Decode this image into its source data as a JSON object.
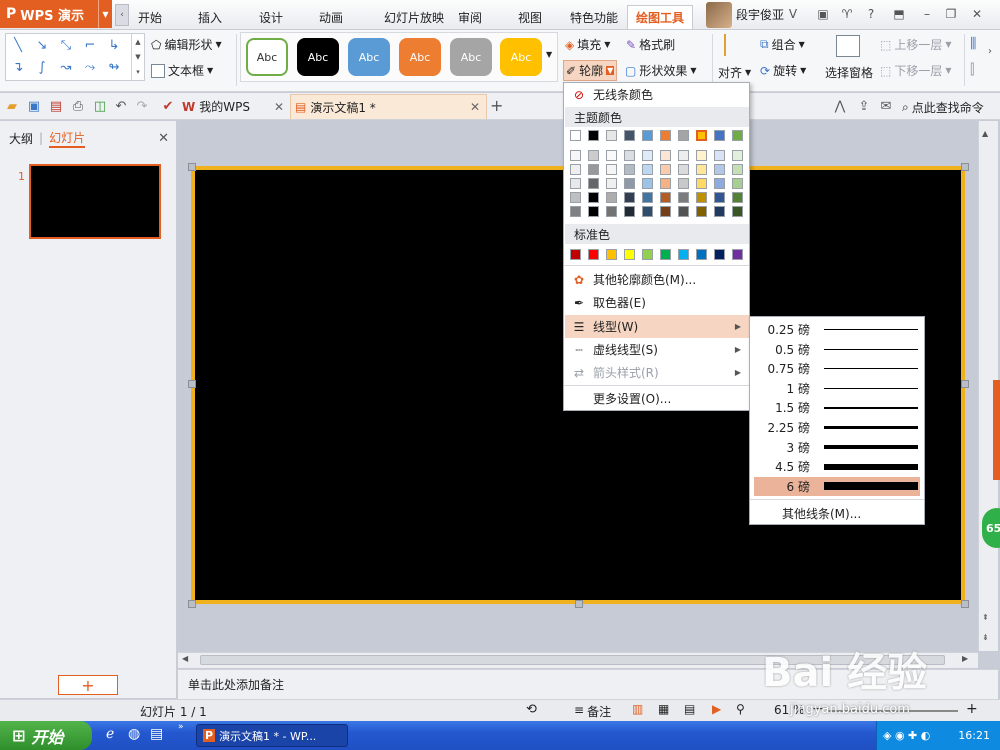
{
  "app": {
    "logo_text": "WPS 演示",
    "logo_letter": "P"
  },
  "menu": {
    "tabs": [
      "开始",
      "插入",
      "设计",
      "动画",
      "幻灯片放映",
      "审阅",
      "视图",
      "特色功能",
      "绘图工具"
    ],
    "user": "段宇俊亚"
  },
  "ribbon": {
    "edit_shape": "编辑形状",
    "text_box": "文本框",
    "style_label": "Abc",
    "fill": "填充",
    "format_painter": "格式刷",
    "outline": "轮廓",
    "shape_effect": "形状效果",
    "align": "对齐",
    "group": "组合",
    "rotate": "旋转",
    "selection_pane": "选择窗格",
    "bring_forward": "上移一层",
    "send_backward": "下移一层"
  },
  "colors": {
    "accent": "#e35f21",
    "slide_border": "#f0b21c",
    "style_colors": [
      "#ffffff",
      "#000000",
      "#5b9bd5",
      "#ed7d31",
      "#a5a5a5",
      "#ffc000"
    ],
    "theme_row": [
      "#ffffff",
      "#000000",
      "#e7e6e6",
      "#44546a",
      "#5b9bd5",
      "#ed7d31",
      "#a5a5a5",
      "#ffc000",
      "#4472c4",
      "#70ad47"
    ],
    "standard_row": [
      "#c00000",
      "#ff0000",
      "#ffc000",
      "#ffff00",
      "#92d050",
      "#00b050",
      "#00b0f0",
      "#0070c0",
      "#002060",
      "#7030a0"
    ]
  },
  "qabar": {
    "doc_tab_1": "我的WPS",
    "doc_tab_2": "演示文稿1 *",
    "find_command": "点此查找命令"
  },
  "left_pane": {
    "tab_outline": "大纲",
    "tab_slides": "幻灯片",
    "slide_number": "1",
    "add_button": "+"
  },
  "notes": {
    "placeholder": "单击此处添加备注"
  },
  "statusbar": {
    "slide_info": "幻灯片 1 / 1",
    "notes_button": "备注",
    "zoom": "61 %"
  },
  "outline_menu": {
    "no_line": "无线条颜色",
    "theme_colors": "主题颜色",
    "standard_colors": "标准色",
    "more_colors": "其他轮廓颜色(M)...",
    "eyedropper": "取色器(E)",
    "line_style": "线型(W)",
    "dash_style": "虚线线型(S)",
    "arrow_style": "箭头样式(R)",
    "more_settings": "更多设置(O)..."
  },
  "line_menu": {
    "options": [
      {
        "label": "0.25 磅",
        "weight": 0.25
      },
      {
        "label": "0.5 磅",
        "weight": 0.5
      },
      {
        "label": "0.75 磅",
        "weight": 0.75
      },
      {
        "label": "1 磅",
        "weight": 1
      },
      {
        "label": "1.5 磅",
        "weight": 1.5
      },
      {
        "label": "2.25 磅",
        "weight": 2.25
      },
      {
        "label": "3 磅",
        "weight": 3
      },
      {
        "label": "4.5 磅",
        "weight": 4.5
      },
      {
        "label": "6 磅",
        "weight": 6
      }
    ],
    "selected": "6 磅",
    "more_lines": "其他线条(M)..."
  },
  "taskbar": {
    "start": "开始",
    "app": "演示文稿1 * - WP...",
    "clock": "16:21"
  },
  "watermark": {
    "logo": "Bai 经验",
    "url": "jingyan.baidu.com"
  },
  "badge": "65"
}
